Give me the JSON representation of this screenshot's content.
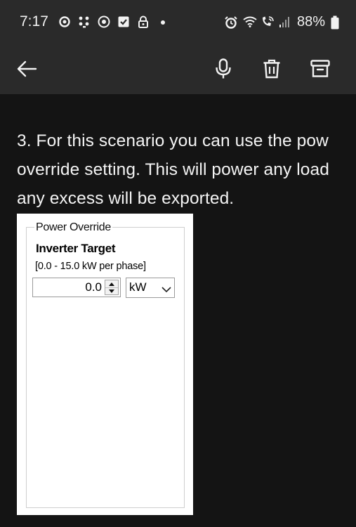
{
  "status_bar": {
    "time": "7:17",
    "battery_percent": "88%",
    "left_icons": [
      "threads-icon",
      "dots-icon",
      "chrome-icon",
      "check-icon",
      "lock-icon",
      "dot-icon"
    ],
    "right_icons": [
      "alarm-icon",
      "wifi-icon",
      "wifi-calling-icon",
      "signal-icon",
      "battery-icon"
    ]
  },
  "app_bar": {
    "icons": [
      "back-arrow-icon",
      "microphone-icon",
      "trash-icon",
      "archive-icon"
    ]
  },
  "content": {
    "line1": "3. For this scenario you can use the pow",
    "line2": "override setting. This will power any load",
    "line3": "any excess will be exported."
  },
  "screenshot_image": {
    "group_label": "Power Override",
    "title": "Inverter Target",
    "range": "[0.0 - 15.0 kW per phase]",
    "value": "0.0",
    "unit": "kW"
  },
  "colors": {
    "background": "#141414",
    "bar": "#2a2a2a",
    "text": "#f4f4f4"
  }
}
